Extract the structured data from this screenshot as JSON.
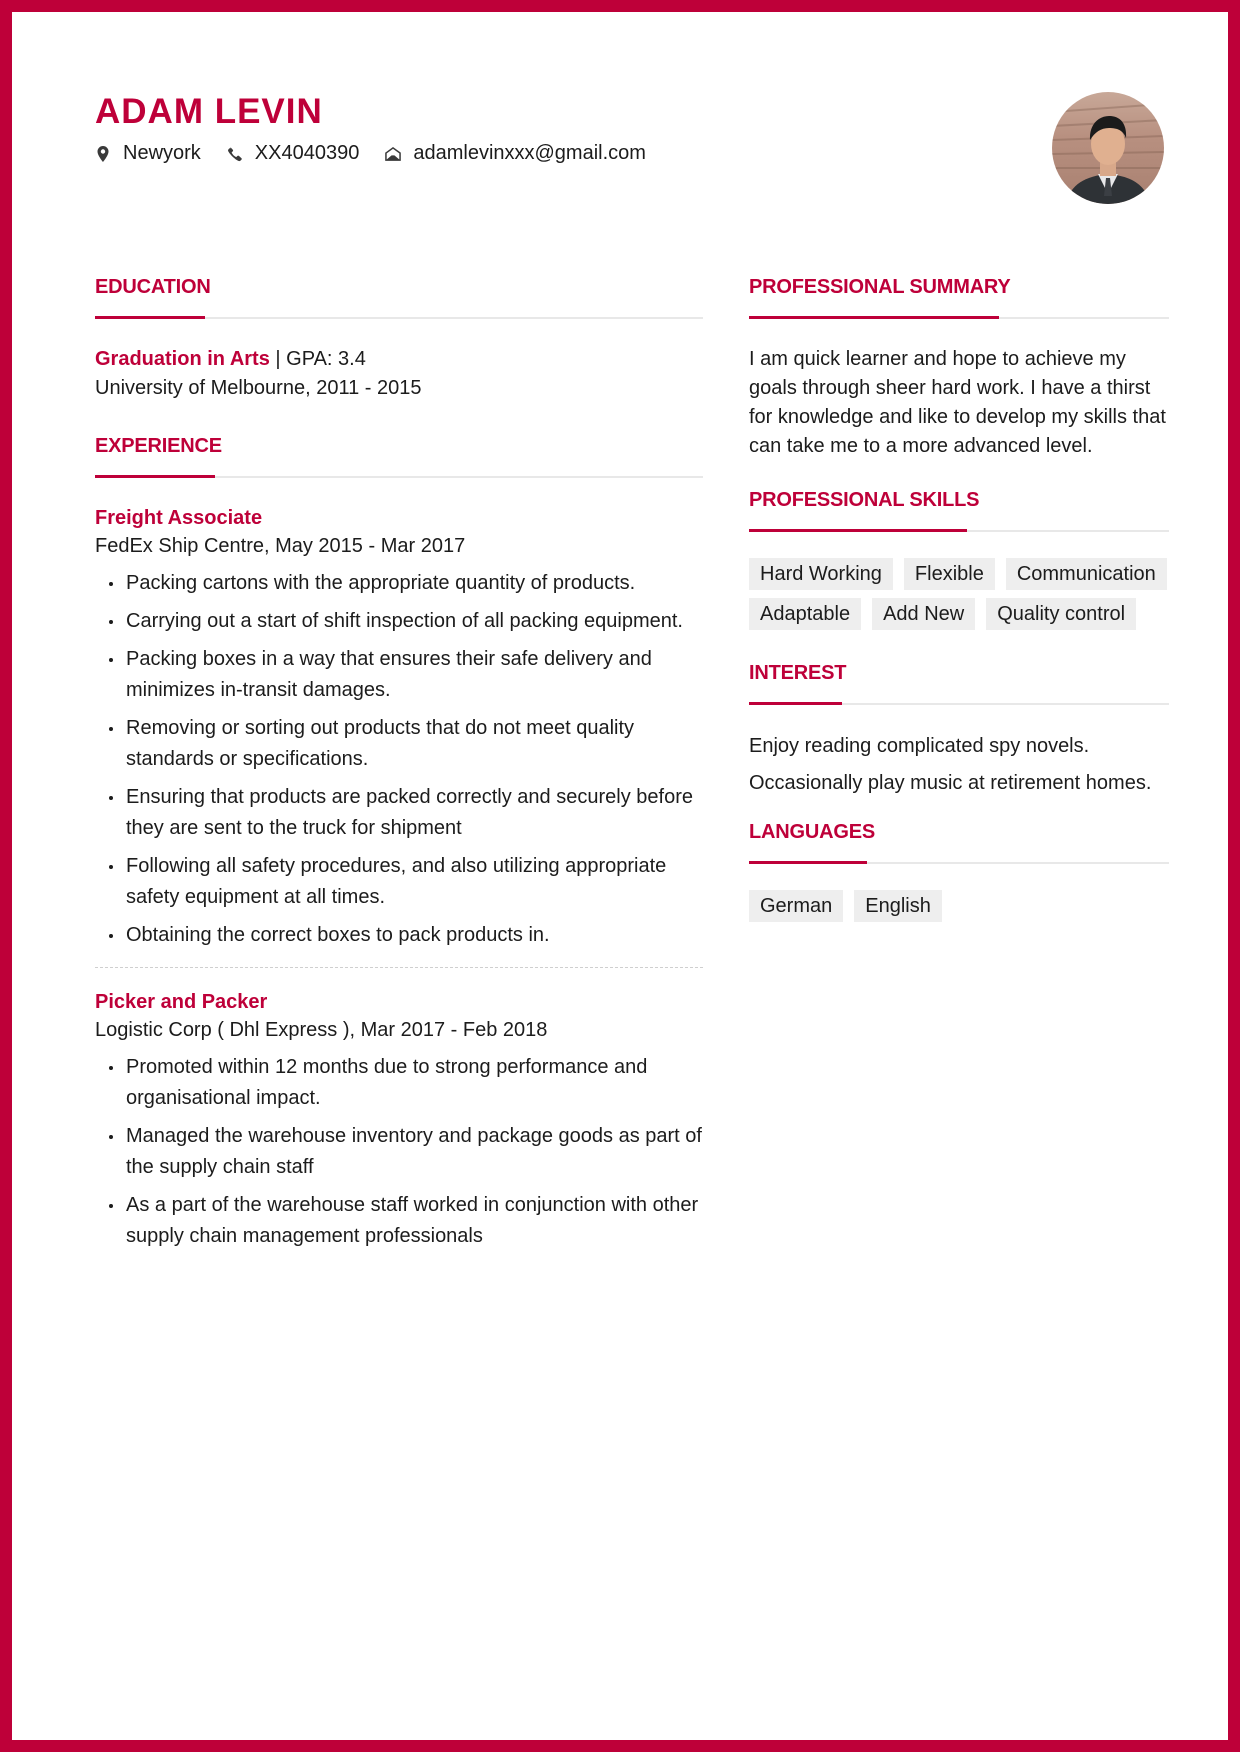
{
  "colors": {
    "accent": "#be0039",
    "tag_bg": "#eeeeee",
    "rule": "#e8e8e8"
  },
  "header": {
    "name": "ADAM LEVIN",
    "contacts": [
      {
        "icon": "map-pin-icon",
        "text": "Newyork"
      },
      {
        "icon": "phone-icon",
        "text": "XX4040390"
      },
      {
        "icon": "envelope-open-icon",
        "text": "adamlevinxxx@gmail.com"
      }
    ],
    "photo": "profile-photo"
  },
  "education": {
    "title": "EDUCATION",
    "degree": "Graduation in Arts",
    "separator": "|",
    "gpa": " GPA: 3.4",
    "school_line": "University of Melbourne, 2011 - 2015"
  },
  "experience": {
    "title": "EXPERIENCE",
    "jobs": [
      {
        "title": "Freight Associate",
        "subtitle": "FedEx Ship Centre, May 2015 - Mar 2017",
        "bullets": [
          "Packing cartons with the appropriate quantity of products.",
          "Carrying out a start of shift inspection of all packing equipment.",
          "Packing boxes in a way that ensures their safe delivery and minimizes in-transit damages.",
          "Removing or sorting out products that do not meet quality standards or specifications.",
          "Ensuring that products are packed correctly and securely before they are sent to the truck for shipment",
          "Following all safety procedures, and also utilizing appropriate safety equipment at all times.",
          "Obtaining the correct boxes to pack products in."
        ]
      },
      {
        "title": "Picker and Packer",
        "subtitle": "Logistic Corp ( Dhl Express ), Mar 2017 - Feb 2018",
        "bullets": [
          "Promoted within 12 months due to strong performance and organisational impact.",
          "Managed the warehouse inventory and package goods as part of the supply chain staff",
          "As a part of the warehouse staff worked in conjunction with other supply chain management professionals"
        ]
      }
    ]
  },
  "summary": {
    "title": "PROFESSIONAL SUMMARY",
    "text": "I am quick learner and hope to achieve my goals through sheer hard work. I have a thirst for knowledge and like to develop my skills that can take me to a more advanced level."
  },
  "skills": {
    "title": "PROFESSIONAL SKILLS",
    "items": [
      "Hard Working",
      "Flexible",
      "Communication",
      "Adaptable",
      "Add New",
      "Quality control"
    ]
  },
  "interest": {
    "title": "INTEREST",
    "items": [
      "Enjoy reading complicated spy novels.",
      "Occasionally play music at retirement homes."
    ]
  },
  "languages": {
    "title": "LANGUAGES",
    "items": [
      "German",
      "English"
    ]
  }
}
